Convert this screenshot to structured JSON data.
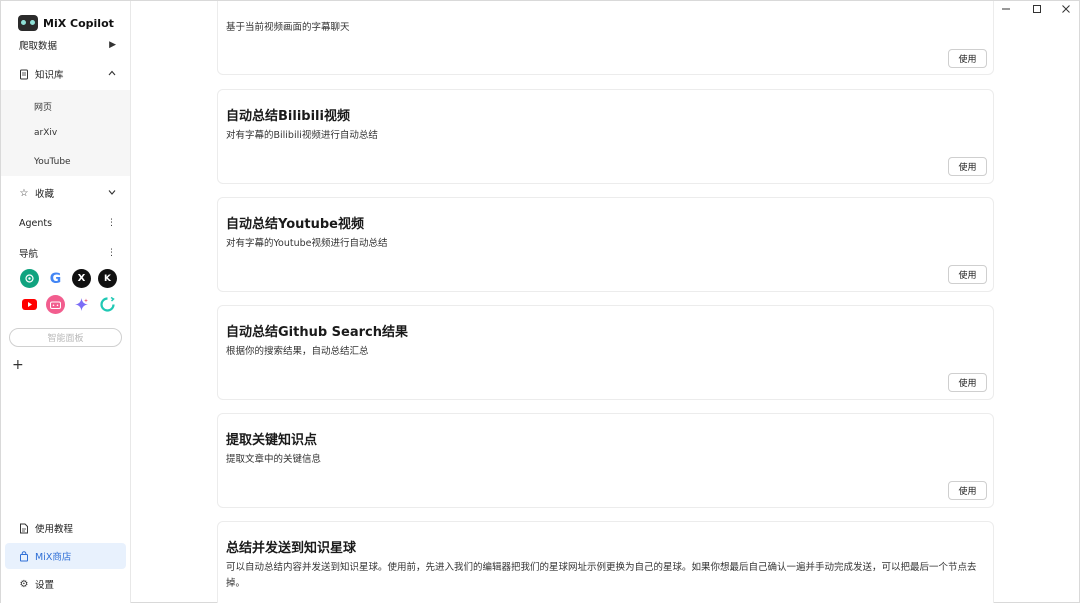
{
  "app": {
    "name": "MiX Copilot"
  },
  "sidebar": {
    "crawl": "爬取数据",
    "knowledge": "知识库",
    "knowledge_subitems": [
      "网页",
      "arXiv",
      "YouTube"
    ],
    "favorites": "收藏",
    "agents": "Agents",
    "navigation": "导航",
    "smart_panel": "智能面板",
    "add": "+",
    "tutorial": "使用教程",
    "store": "MiX商店",
    "settings": "设置"
  },
  "nav_icons": [
    "chatgpt-icon",
    "google-icon",
    "x-icon",
    "kimi-icon",
    "youtube-icon",
    "bilibili-icon",
    "gemini-icon",
    "refresh-app-icon"
  ],
  "cards": [
    {
      "title": "",
      "desc": "基于当前视频画面的字幕聊天",
      "button": "使用"
    },
    {
      "title": "自动总结Bilibili视频",
      "desc": "对有字幕的Bilibili视频进行自动总结",
      "button": "使用"
    },
    {
      "title": "自动总结Youtube视频",
      "desc": "对有字幕的Youtube视频进行自动总结",
      "button": "使用"
    },
    {
      "title": "自动总结Github Search结果",
      "desc": "根据你的搜索结果，自动总结汇总",
      "button": "使用"
    },
    {
      "title": "提取关键知识点",
      "desc": "提取文章中的关键信息",
      "button": "使用"
    },
    {
      "title": "总结并发送到知识星球",
      "desc": "可以自动总结内容并发送到知识星球。使用前，先进入我们的编辑器把我们的星球网址示例更换为自己的星球。如果你想最后自己确认一遍并手动完成发送，可以把最后一个节点去掉。",
      "button": ""
    }
  ],
  "colors": {
    "accent": "#2f6fd6",
    "active_bg": "#e8f1fd"
  }
}
